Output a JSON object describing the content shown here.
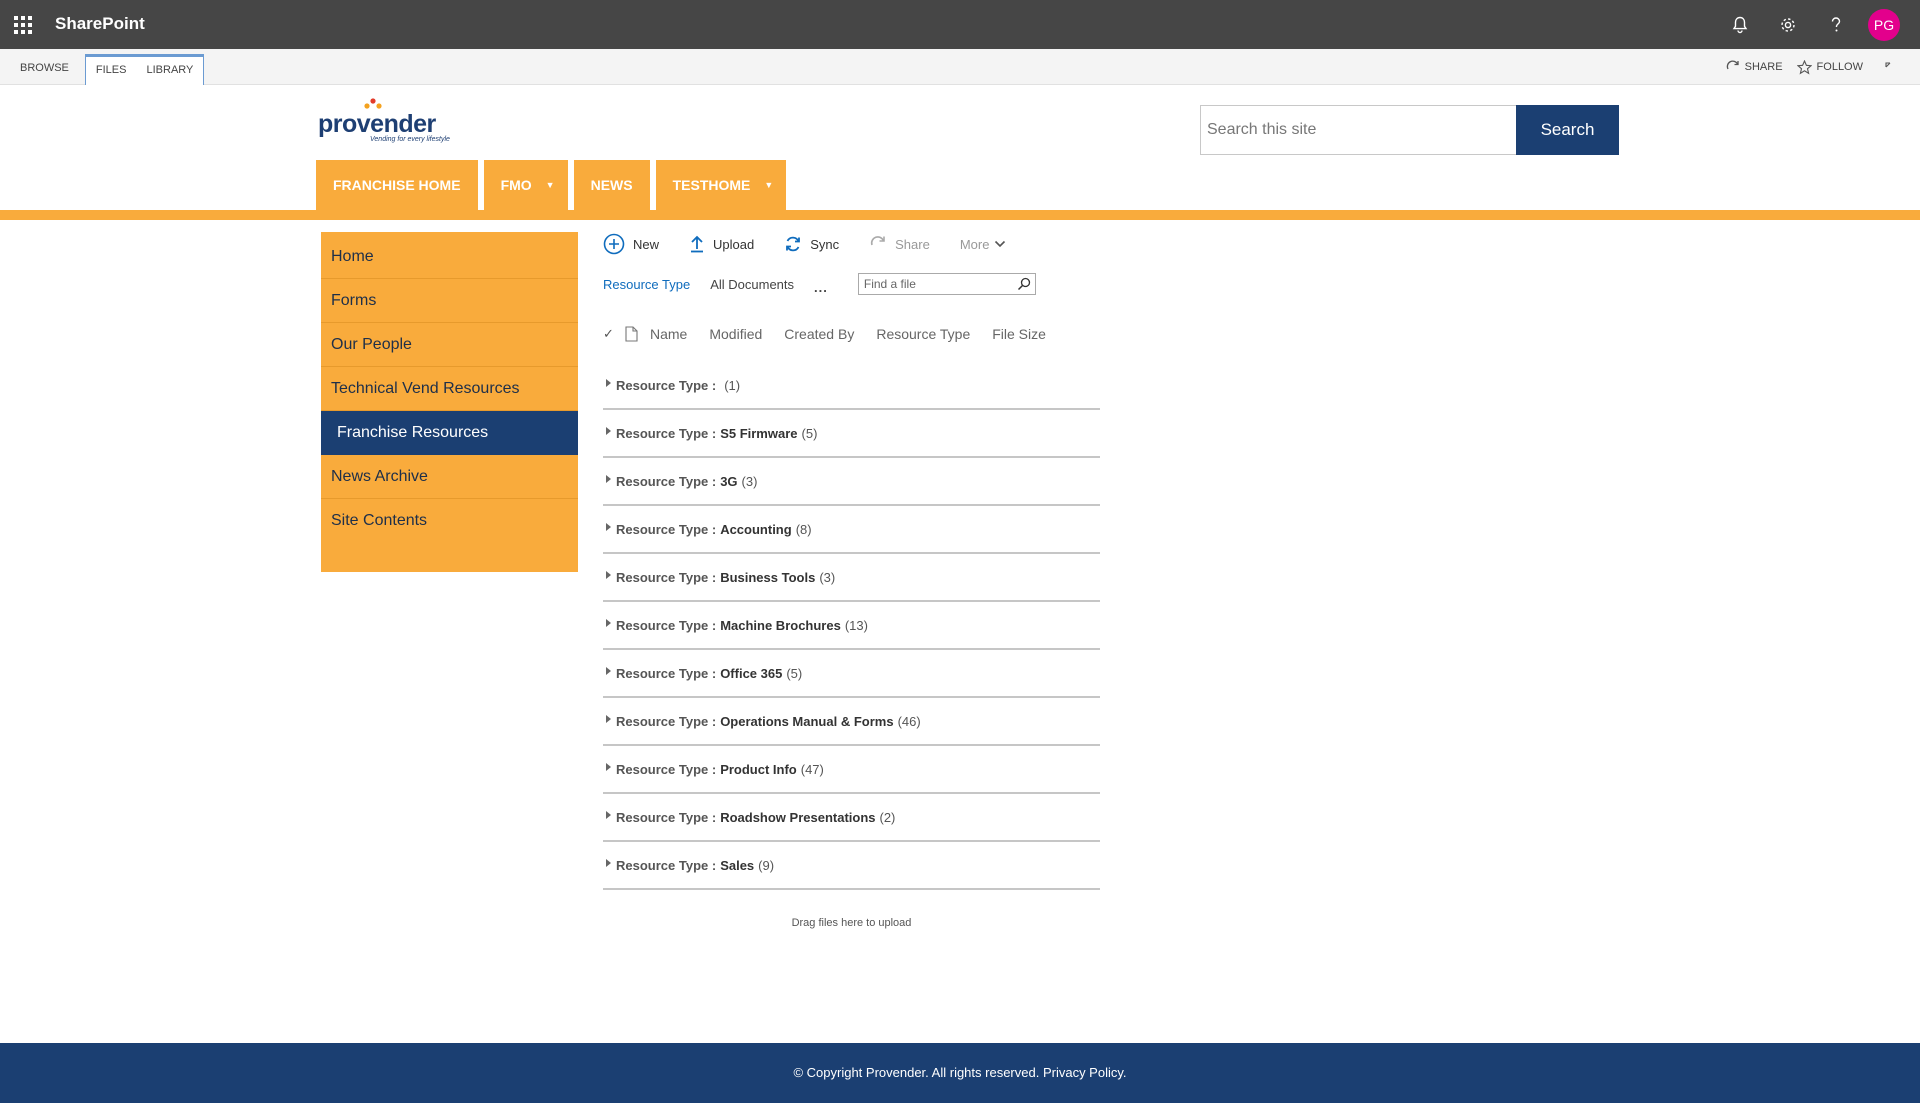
{
  "suite": {
    "app_name": "SharePoint",
    "avatar_initials": "PG"
  },
  "ribbon": {
    "tabs": [
      "BROWSE",
      "FILES",
      "LIBRARY"
    ],
    "share_label": "SHARE",
    "follow_label": "FOLLOW"
  },
  "header": {
    "logo_text": "provender",
    "logo_tagline": "Vending for every lifestyle",
    "search_placeholder": "Search this site",
    "search_button": "Search"
  },
  "top_nav": [
    {
      "label": "FRANCHISE HOME",
      "has_menu": false
    },
    {
      "label": "FMO",
      "has_menu": true
    },
    {
      "label": "NEWS",
      "has_menu": false
    },
    {
      "label": "TESTHOME",
      "has_menu": true
    }
  ],
  "left_nav": [
    {
      "label": "Home"
    },
    {
      "label": "Forms"
    },
    {
      "label": "Our People"
    },
    {
      "label": "Technical Vend Resources"
    },
    {
      "label": "Franchise Resources"
    },
    {
      "label": "News Archive"
    },
    {
      "label": "Site Contents"
    }
  ],
  "left_nav_active": "Franchise Resources",
  "command_bar": {
    "new": "New",
    "upload": "Upload",
    "sync": "Sync",
    "share": "Share",
    "more": "More"
  },
  "views": {
    "resource_type": "Resource Type",
    "all_documents": "All Documents",
    "ellipsis": "...",
    "find_placeholder": "Find a file"
  },
  "columns": [
    "Name",
    "Modified",
    "Created By",
    "Resource Type",
    "File Size"
  ],
  "groups": [
    {
      "label": "Resource Type :",
      "value": "",
      "count": "(1)"
    },
    {
      "label": "Resource Type :",
      "value": "S5 Firmware",
      "count": "(5)"
    },
    {
      "label": "Resource Type :",
      "value": "3G",
      "count": "(3)"
    },
    {
      "label": "Resource Type :",
      "value": "Accounting",
      "count": "(8)"
    },
    {
      "label": "Resource Type :",
      "value": "Business Tools",
      "count": "(3)"
    },
    {
      "label": "Resource Type :",
      "value": "Machine Brochures",
      "count": "(13)"
    },
    {
      "label": "Resource Type :",
      "value": "Office 365",
      "count": "(5)"
    },
    {
      "label": "Resource Type :",
      "value": "Operations Manual & Forms",
      "count": "(46)"
    },
    {
      "label": "Resource Type :",
      "value": "Product Info",
      "count": "(47)"
    },
    {
      "label": "Resource Type :",
      "value": "Roadshow Presentations",
      "count": "(2)"
    },
    {
      "label": "Resource Type :",
      "value": "Sales",
      "count": "(9)"
    }
  ],
  "drop_message": "Drag files here to upload",
  "footer": {
    "copyright": "© Copyright Provender. All rights reserved.",
    "privacy": "Privacy Policy."
  },
  "colors": {
    "suitebar": "#464646",
    "accent_orange": "#f9ab3c",
    "navy": "#1b3f72",
    "avatar": "#e3008c",
    "link_blue": "#0f6cbd"
  }
}
